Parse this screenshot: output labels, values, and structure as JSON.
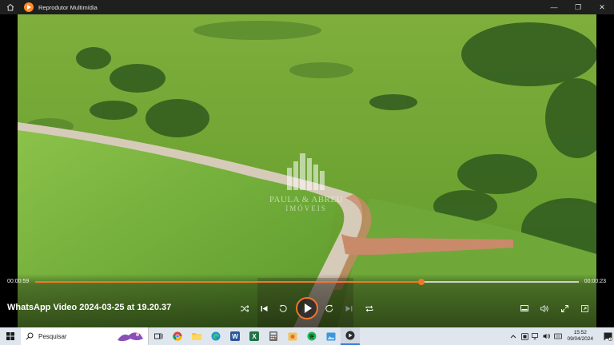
{
  "window": {
    "title": "Reprodutor Multimídia",
    "controls": {
      "minimize": "—",
      "maximize": "❐",
      "close": "✕"
    }
  },
  "video": {
    "watermark_name": "PAULA & ABREU",
    "watermark_sub": "IMÓVEIS",
    "title": "WhatsApp Video 2024-03-25 at 19.20.37"
  },
  "player": {
    "elapsed": "00:00:59",
    "remaining": "00:00:23",
    "progress_fraction": 0.71,
    "accent_color": "#f2762a"
  },
  "taskbar": {
    "search_placeholder": "Pesquisar",
    "apps": [
      "task-view-icon",
      "chrome-icon",
      "file-explorer-icon",
      "edge-icon",
      "word-icon",
      "excel-icon",
      "calculator-icon",
      "photos-icon",
      "spotify-icon",
      "photo-viewer-icon",
      "media-player-icon"
    ],
    "time": "15:52",
    "date": "09/04/2024"
  }
}
